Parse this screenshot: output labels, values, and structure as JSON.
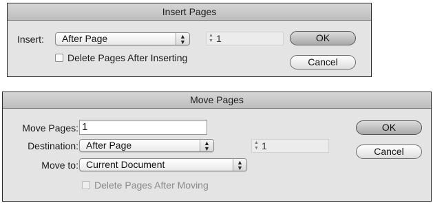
{
  "insert_dialog": {
    "title": "Insert Pages",
    "insert_label": "Insert:",
    "insert_popup_value": "After Page",
    "page_number": "1",
    "ok_label": "OK",
    "cancel_label": "Cancel",
    "delete_checkbox_label": "Delete Pages After Inserting",
    "delete_checked": false
  },
  "move_dialog": {
    "title": "Move Pages",
    "move_pages_label": "Move Pages:",
    "move_pages_value": "1",
    "destination_label": "Destination:",
    "destination_value": "After Page",
    "page_number": "1",
    "move_to_label": "Move to:",
    "move_to_value": "Current Document",
    "delete_checkbox_label": "Delete Pages After Moving",
    "delete_checked": false,
    "ok_label": "OK",
    "cancel_label": "Cancel"
  },
  "icons": {
    "popup_arrows": "up-down-chevron-icon",
    "stepper_arrows": "stepper-icon"
  }
}
